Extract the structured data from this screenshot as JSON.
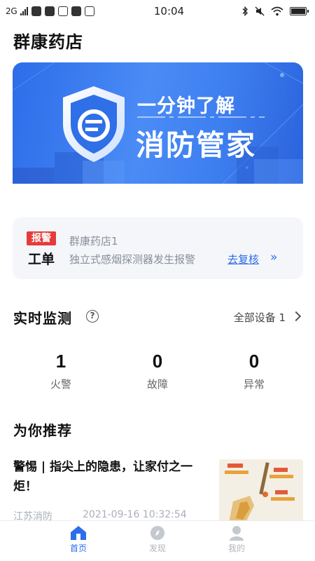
{
  "status_bar": {
    "network": "2G",
    "time": "10:04"
  },
  "store_title": "群康药店",
  "banner": {
    "line1": "一分钟了解",
    "line2": "消防管家"
  },
  "alarm": {
    "badge_top": "报警",
    "badge_bottom": "工单",
    "store_name": "群康药店1",
    "message": "独立式感烟探测器发生报警",
    "link_label": "去复核",
    "link_arrows": "»"
  },
  "monitor": {
    "title": "实时监测",
    "help": "?",
    "all_devices_label": "全部设备 1",
    "stats": [
      {
        "value": "1",
        "label": "火警"
      },
      {
        "value": "0",
        "label": "故障"
      },
      {
        "value": "0",
        "label": "异常"
      }
    ]
  },
  "recommend": {
    "title": "为你推荐",
    "article": {
      "title": "警惕 | 指尖上的隐患，让家付之一炬！",
      "source": "江苏消防",
      "date": "2021-09-16 10:32:54"
    }
  },
  "tabs": [
    {
      "label": "首页",
      "active": true
    },
    {
      "label": "发现",
      "active": false
    },
    {
      "label": "我的",
      "active": false
    }
  ],
  "colors": {
    "accent": "#2d6de9",
    "alarm_red": "#e53b3b",
    "muted_text": "#8a8f99",
    "inactive_tab": "#b0b4bb"
  },
  "icons": {
    "banner": "shield-logo-icon",
    "help": "question-circle-icon",
    "chevron": "chevron-right-icon",
    "tab_home": "home-icon",
    "tab_discover": "compass-icon",
    "tab_me": "user-icon"
  }
}
